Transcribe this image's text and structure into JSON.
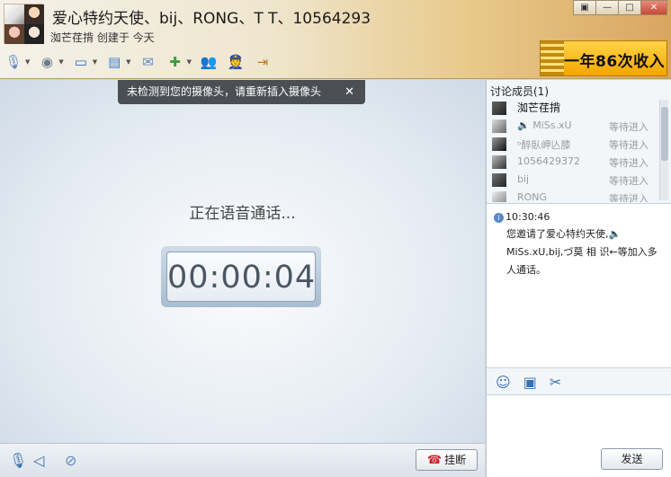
{
  "header": {
    "title": "爱心特约天使、bij、RONG、T T、10564293",
    "subtitle": "洳芒荏揹  创建于 今天",
    "window_controls": [
      "▣",
      "—",
      "□",
      "✕"
    ]
  },
  "toolbar": {
    "items": [
      {
        "name": "microphone-icon",
        "glyph": "🎙",
        "dropdown": true
      },
      {
        "name": "camera-icon",
        "glyph": "◉",
        "dropdown": true
      },
      {
        "name": "screen-share-icon",
        "glyph": "▭",
        "dropdown": true
      },
      {
        "name": "folder-icon",
        "glyph": "▤",
        "dropdown": true
      },
      {
        "name": "mail-icon",
        "glyph": "✉",
        "dropdown": false
      },
      {
        "name": "add-message-icon",
        "glyph": "✚",
        "dropdown": true
      },
      {
        "name": "friends-icon",
        "glyph": "👥",
        "dropdown": false
      },
      {
        "name": "police-icon",
        "glyph": "👮",
        "dropdown": false
      },
      {
        "name": "exit-icon",
        "glyph": "⇥",
        "dropdown": false
      }
    ]
  },
  "ad": {
    "text": "一年86次收入"
  },
  "notice": {
    "text": "未检测到您的摄像头，请重新插入摄像头",
    "close": "✕"
  },
  "call": {
    "status": "正在语音通话...",
    "timer": "00:00:04"
  },
  "bottom": {
    "hangup_label": "挂断",
    "hangup_glyph": "☎"
  },
  "members": {
    "header": "讨论成员(1)",
    "list": [
      {
        "name": "洳芒荏揹",
        "status": "",
        "owner": true
      },
      {
        "name": "🔈 MiSs.xU",
        "status": "等待进入"
      },
      {
        "name": "ᵒ醉臥岬亾膝",
        "status": "等待进入"
      },
      {
        "name": "1056429372",
        "status": "等待进入"
      },
      {
        "name": "bij",
        "status": "等待进入"
      },
      {
        "name": "RONG",
        "status": "等待进入"
      }
    ]
  },
  "messages": {
    "time": "10:30:46",
    "text": "您邀请了爱心特约天使,🔈 MiSs.xU,bij,づ莫 相 识←等加入多人通话。"
  },
  "input": {
    "send_label": "发送"
  }
}
